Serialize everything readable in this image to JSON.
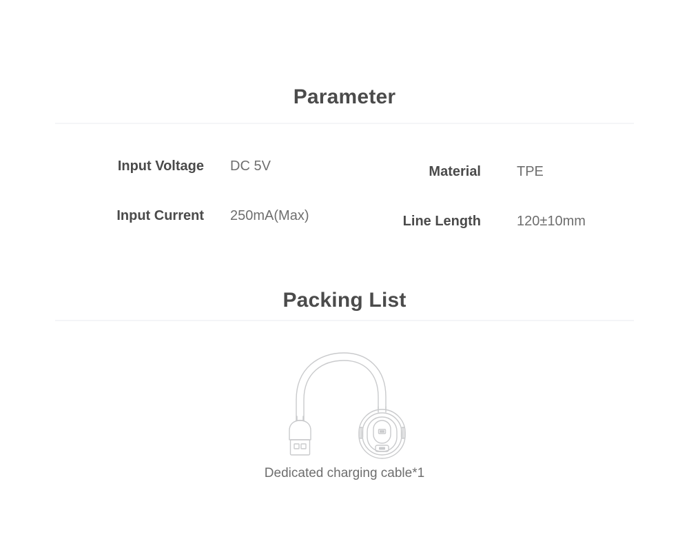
{
  "sections": {
    "parameter": {
      "title": "Parameter",
      "rows": {
        "input_voltage": {
          "label": "Input Voltage",
          "value": "DC 5V"
        },
        "input_current": {
          "label": "Input Current",
          "value": "250mA(Max)"
        },
        "material": {
          "label": "Material",
          "value": "TPE"
        },
        "line_length": {
          "label": "Line Length",
          "value": "120±10mm"
        }
      }
    },
    "packing": {
      "title": "Packing List",
      "item": {
        "caption": "Dedicated charging cable*1",
        "illustration": "usb-charging-cable-illustration"
      }
    }
  },
  "colors": {
    "heading_text": "#4b4b4b",
    "label_text": "#4a4a4a",
    "value_text": "#6e6e6e",
    "divider": "#f4f5f7",
    "line_art_stroke": "#c9cacc",
    "background": "#ffffff"
  }
}
